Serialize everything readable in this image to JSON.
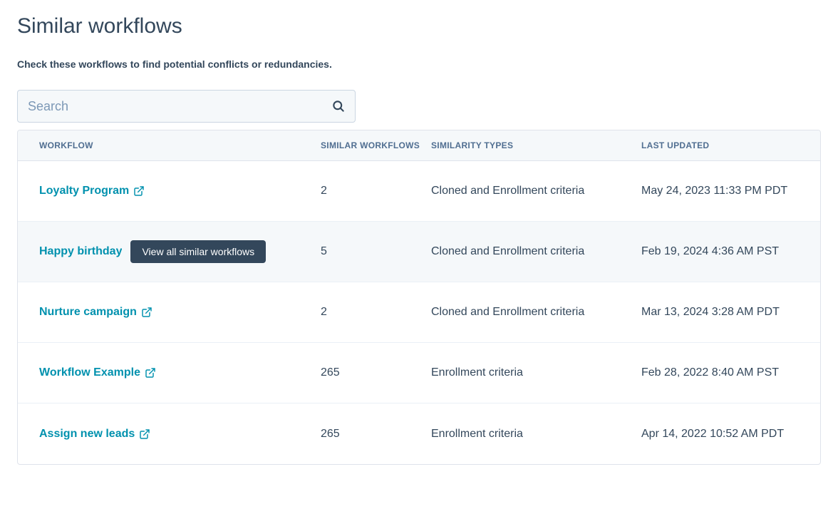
{
  "page": {
    "title": "Similar workflows",
    "subtitle": "Check these workflows to find potential conflicts or redundancies."
  },
  "search": {
    "placeholder": "Search",
    "value": ""
  },
  "table": {
    "headers": {
      "workflow": "WORKFLOW",
      "similar": "SIMILAR WORKFLOWS",
      "types": "SIMILARITY TYPES",
      "updated": "LAST UPDATED"
    },
    "action_label": "View all similar workflows",
    "rows": [
      {
        "name": "Loyalty Program",
        "similar": "2",
        "types": "Cloned and Enrollment criteria",
        "updated": "May 24, 2023 11:33 PM PDT",
        "hovered": false
      },
      {
        "name": "Happy birthday",
        "similar": "5",
        "types": "Cloned and Enrollment criteria",
        "updated": "Feb 19, 2024 4:36 AM PST",
        "hovered": true
      },
      {
        "name": "Nurture campaign",
        "similar": "2",
        "types": "Cloned and Enrollment criteria",
        "updated": "Mar 13, 2024 3:28 AM PDT",
        "hovered": false
      },
      {
        "name": "Workflow Example",
        "similar": "265",
        "types": "Enrollment criteria",
        "updated": "Feb 28, 2022 8:40 AM PST",
        "hovered": false
      },
      {
        "name": "Assign new leads",
        "similar": "265",
        "types": "Enrollment criteria",
        "updated": "Apr 14, 2022 10:52 AM PDT",
        "hovered": false
      }
    ]
  }
}
